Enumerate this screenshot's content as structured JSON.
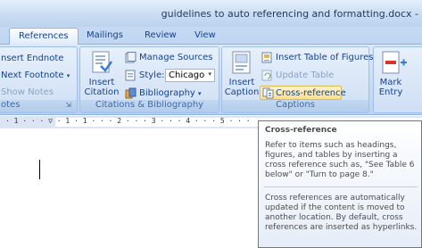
{
  "window": {
    "title": "guidelines to auto referencing and formatting.docx -"
  },
  "tabs": [
    {
      "label": "References",
      "active": true
    },
    {
      "label": "Mailings",
      "active": false
    },
    {
      "label": "Review",
      "active": false
    },
    {
      "label": "View",
      "active": false
    }
  ],
  "groups": {
    "footnotes": {
      "label": "otes",
      "insert_endnote": "nsert Endnote",
      "next_footnote": "Next Footnote",
      "show_notes": "Show Notes"
    },
    "citations": {
      "label": "Citations & Bibliography",
      "insert_citation": "Insert Citation",
      "manage_sources": "Manage Sources",
      "style_label": "Style:",
      "style_value": "Chicago",
      "bibliography": "Bibliography"
    },
    "captions": {
      "label": "Captions",
      "insert_caption": "Insert Caption",
      "insert_table_of_figures": "Insert Table of Figures",
      "update_table": "Update Table",
      "cross_reference": "Cross-reference"
    },
    "index": {
      "mark_entry": "Mark Entry"
    }
  },
  "ruler": {
    "text": "· 1 · · · ▽ · 1 · 1 · · · 2 · · · 3 · · · 4 · · · 5 · · ·"
  },
  "tooltip": {
    "title": "Cross-reference",
    "para1": "Refer to items such as headings, figures, and tables by inserting a cross reference such as, \"See Table 6 below\" or \"Turn to page 8.\"",
    "para2": "Cross references are automatically updated if the content is moved to another location. By default, cross references are inserted as hyperlinks."
  },
  "colors": {
    "ribbon_text": "#15428b",
    "highlight": "#ffe08a",
    "tooltip_border": "#767676"
  }
}
